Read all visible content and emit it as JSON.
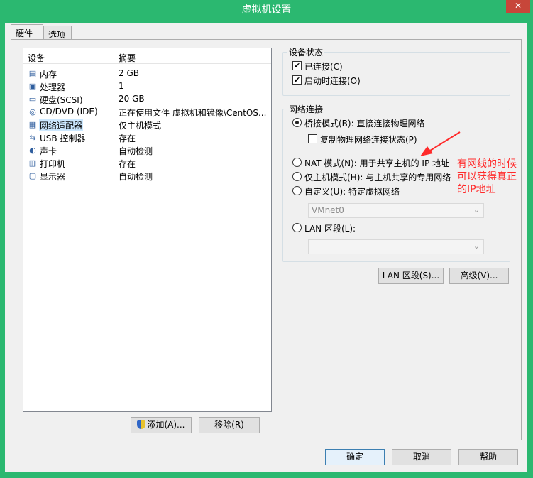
{
  "window": {
    "title": "虚拟机设置",
    "close_label": "✕"
  },
  "tabs": [
    "硬件",
    "选项"
  ],
  "device_list": {
    "headers": {
      "device": "设备",
      "summary": "摘要"
    },
    "rows": [
      {
        "icon": "memory-icon",
        "glyph": "▤",
        "label": "内存",
        "summary": "2 GB"
      },
      {
        "icon": "processor-icon",
        "glyph": "▣",
        "label": "处理器",
        "summary": "1"
      },
      {
        "icon": "hard-disk-icon",
        "glyph": "▭",
        "label": "硬盘(SCSI)",
        "summary": "20 GB"
      },
      {
        "icon": "cd-dvd-icon",
        "glyph": "◎",
        "label": "CD/DVD (IDE)",
        "summary": "正在使用文件 虚拟机和镜像\\CentOS..."
      },
      {
        "icon": "network-adapter-icon",
        "glyph": "▦",
        "label": "网络适配器",
        "summary": "仅主机模式"
      },
      {
        "icon": "usb-icon",
        "glyph": "⇆",
        "label": "USB 控制器",
        "summary": "存在"
      },
      {
        "icon": "sound-card-icon",
        "glyph": "◐",
        "label": "声卡",
        "summary": "自动检测"
      },
      {
        "icon": "printer-icon",
        "glyph": "▥",
        "label": "打印机",
        "summary": "存在"
      },
      {
        "icon": "display-icon",
        "glyph": "▢",
        "label": "显示器",
        "summary": "自动检测"
      }
    ],
    "selected_index": 4
  },
  "buttons": {
    "add": "添加(A)...",
    "remove": "移除(R)",
    "lan_segment": "LAN 区段(S)...",
    "advanced": "高级(V)...",
    "ok": "确定",
    "cancel": "取消",
    "help": "帮助"
  },
  "device_status": {
    "title": "设备状态",
    "connected": {
      "label": "已连接(C)",
      "checked": true
    },
    "connect_at_power_on": {
      "label": "启动时连接(O)",
      "checked": true
    }
  },
  "network_connection": {
    "title": "网络连接",
    "bridged": {
      "label": "桥接模式(B): 直接连接物理网络",
      "selected": true
    },
    "replicate": {
      "label": "复制物理网络连接状态(P)",
      "checked": false
    },
    "nat": {
      "label": "NAT 模式(N): 用于共享主机的 IP 地址",
      "selected": false
    },
    "host_only": {
      "label": "仅主机模式(H): 与主机共享的专用网络",
      "selected": false
    },
    "custom": {
      "label": "自定义(U): 特定虚拟网络",
      "selected": false
    },
    "custom_select": "VMnet0",
    "lan_segment": {
      "label": "LAN 区段(L):",
      "selected": false
    },
    "lan_select": ""
  },
  "annotation": {
    "lines": [
      "有网线的时候",
      "可以获得真正",
      "的IP地址"
    ],
    "color": "#ff2a2a"
  },
  "colors": {
    "titlebar": "#2bb870",
    "selection": "#cce8ff",
    "close": "#c7463a"
  }
}
